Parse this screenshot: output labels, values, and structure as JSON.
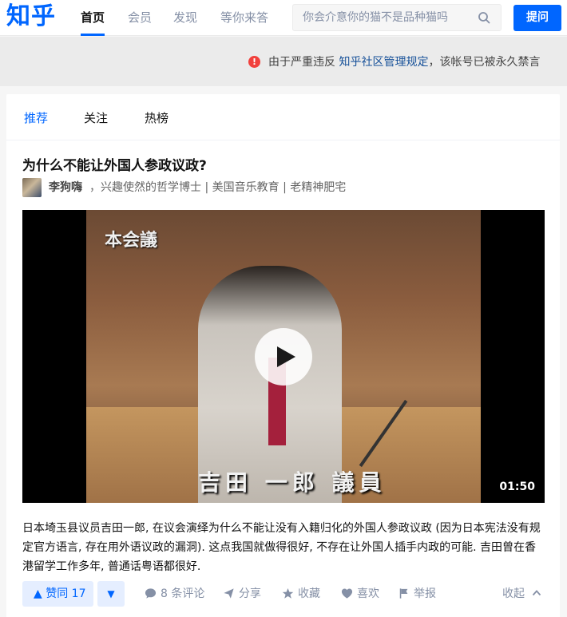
{
  "header": {
    "logo": "知乎",
    "nav": [
      "首页",
      "会员",
      "发现",
      "等你来答"
    ],
    "search_placeholder": "你会介意你的猫不是品种猫吗",
    "ask_button": "提问"
  },
  "banner": {
    "prefix": "由于严重违反",
    "link": "知乎社区管理规定",
    "suffix": "，该帐号已被永久禁言"
  },
  "tabs": [
    "推荐",
    "关注",
    "热榜"
  ],
  "feed_item": {
    "title": "为什么不能让外国人参政议政?",
    "author": "李狗嗨",
    "bio": "，兴趣使然的哲学博士 | 美国音乐教育 | 老精神肥宅",
    "video": {
      "overlay_top": "本会議",
      "caption": "吉田 一郎 議員",
      "duration": "01:50"
    },
    "excerpt": "日本埼玉县议员吉田一郎, 在议会演绎为什么不能让没有入籍归化的外国人参政议政 (因为日本宪法没有规定官方语言, 存在用外语议政的漏洞). 这点我国就做得很好, 不存在让外国人插手内政的可能. 吉田曾在香港留学工作多年, 普通话粤语都很好.",
    "actions": {
      "vote_up": "▲ 赞同 17",
      "vote_down": "▼",
      "comments": "8 条评论",
      "share": "分享",
      "favorite": "收藏",
      "like": "喜欢",
      "report": "举报",
      "collapse": "收起"
    }
  },
  "colors": {
    "brand": "#0066ff",
    "warning": "#f1403c",
    "link": "#175199",
    "muted": "#8590a6"
  }
}
